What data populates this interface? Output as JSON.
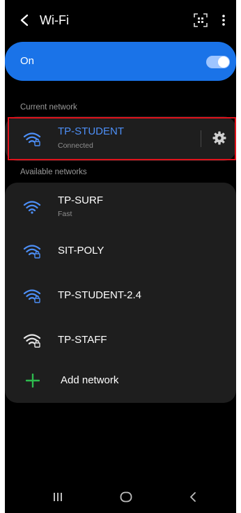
{
  "header": {
    "title": "Wi-Fi",
    "back_icon": "chevron-left-icon",
    "scan_icon": "qr-scan-icon",
    "more_icon": "more-vertical-icon"
  },
  "wifi_toggle": {
    "label": "On",
    "state": "on",
    "accent_color": "#1a73e8"
  },
  "current_network": {
    "section_label": "Current network",
    "name": "TP-STUDENT",
    "status": "Connected",
    "name_color": "#4d8ff7",
    "settings_icon": "gear-icon",
    "highlight_color": "#e0121b"
  },
  "available_networks": {
    "section_label": "Available networks",
    "items": [
      {
        "name": "TP-SURF",
        "subtitle": "Fast",
        "secured": false
      },
      {
        "name": "SIT-POLY",
        "subtitle": "",
        "secured": true
      },
      {
        "name": "TP-STUDENT-2.4",
        "subtitle": "",
        "secured": true
      },
      {
        "name": "TP-STAFF",
        "subtitle": "",
        "secured": true
      }
    ],
    "add_network_label": "Add network",
    "add_icon": "plus-icon",
    "add_icon_color": "#2dbb4e"
  },
  "navigation_bar": {
    "recents_icon": "recent-apps-icon",
    "home_icon": "home-icon",
    "back_icon": "back-icon"
  }
}
